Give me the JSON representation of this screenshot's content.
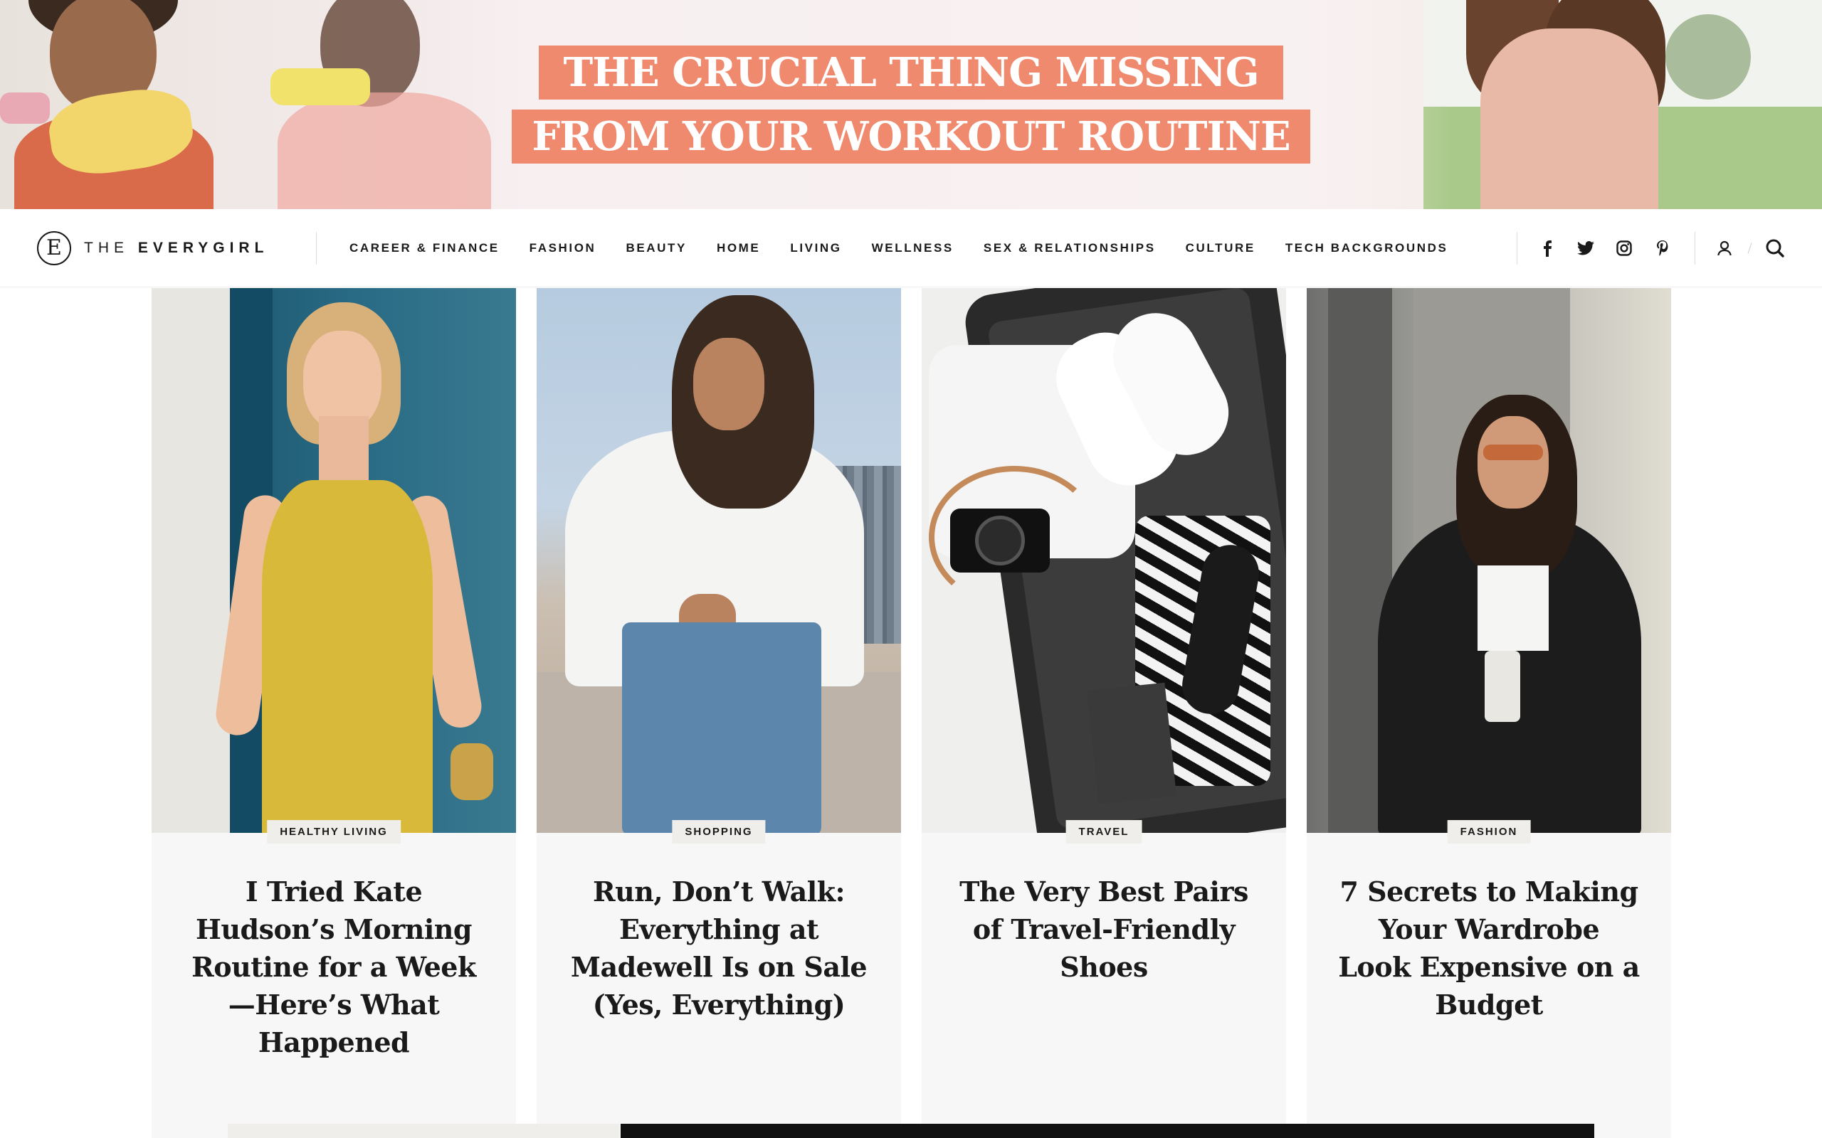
{
  "banner": {
    "headline_line1": "The Crucial Thing Missing",
    "headline_line2": "From Your Workout Routine",
    "accent_color": "#ef8a6f"
  },
  "logo": {
    "mark": "E",
    "text_prefix": "THE ",
    "text_bold": "EVERYGIRL"
  },
  "nav": {
    "items": [
      {
        "label": "CAREER & FINANCE"
      },
      {
        "label": "FASHION"
      },
      {
        "label": "BEAUTY"
      },
      {
        "label": "HOME"
      },
      {
        "label": "LIVING"
      },
      {
        "label": "WELLNESS"
      },
      {
        "label": "SEX & RELATIONSHIPS"
      },
      {
        "label": "CULTURE"
      },
      {
        "label": "TECH BACKGROUNDS"
      }
    ],
    "social": [
      "facebook-icon",
      "twitter-icon",
      "instagram-icon",
      "pinterest-icon"
    ],
    "utilities": [
      "account-icon",
      "search-icon"
    ]
  },
  "cards": [
    {
      "tag": "HEALTHY LIVING",
      "title": "I Tried Kate Hudson’s Morning Routine for a Week—Here’s What Happened"
    },
    {
      "tag": "SHOPPING",
      "title": "Run, Don’t Walk: Everything at Madewell Is on Sale (Yes, Everything)"
    },
    {
      "tag": "TRAVEL",
      "title": "The Very Best Pairs of Travel-Friendly Shoes"
    },
    {
      "tag": "FASHION",
      "title": "7 Secrets to Making Your Wardrobe Look Expensive on a Budget"
    }
  ]
}
